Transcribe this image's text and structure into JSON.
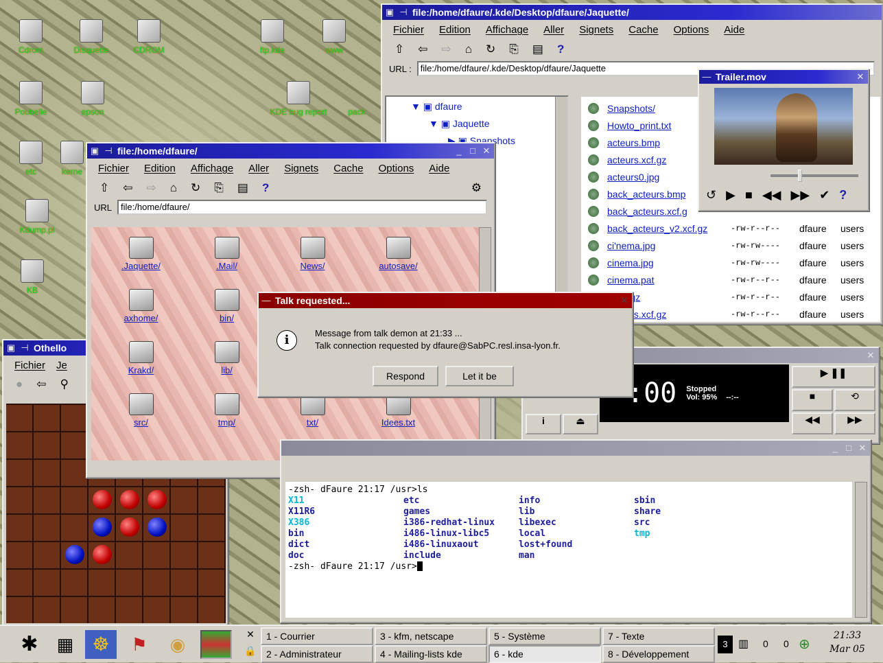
{
  "desktop": {
    "icons": [
      {
        "label": "Cdrom"
      },
      {
        "label": "Disquette"
      },
      {
        "label": "CDROM"
      },
      {
        "label": "ftp.kde"
      },
      {
        "label": "www"
      },
      {
        "label": "Poubelle"
      },
      {
        "label": "epson"
      },
      {
        "label": "KDE bug report"
      },
      {
        "label": "pack"
      },
      {
        "label": "etc"
      },
      {
        "label": "kerne"
      },
      {
        "label": "Kdump.pl"
      },
      {
        "label": "KB"
      }
    ]
  },
  "win_jaquette": {
    "title": "file:/home/dfaure/.kde/Desktop/dfaure/Jaquette/",
    "menu": [
      "Fichier",
      "Edition",
      "Affichage",
      "Aller",
      "Signets",
      "Cache",
      "Options",
      "Aide"
    ],
    "url_label": "URL :",
    "url": "file:/home/dfaure/.kde/Desktop/dfaure/Jaquette",
    "tree": [
      "dfaure",
      "Jaquette",
      "Snapshots"
    ],
    "files": [
      {
        "name": "Snapshots/",
        "perm": "",
        "owner": "",
        "group": ""
      },
      {
        "name": "Howto_print.txt",
        "perm": "",
        "owner": "",
        "group": ""
      },
      {
        "name": "acteurs.bmp",
        "perm": "",
        "owner": "",
        "group": ""
      },
      {
        "name": "acteurs.xcf.gz",
        "perm": "",
        "owner": "",
        "group": ""
      },
      {
        "name": "acteurs0.jpg",
        "perm": "",
        "owner": "",
        "group": ""
      },
      {
        "name": "back_acteurs.bmp",
        "perm": "",
        "owner": "",
        "group": ""
      },
      {
        "name": "back_acteurs.xcf.g",
        "perm": "",
        "owner": "",
        "group": ""
      },
      {
        "name": "back_acteurs_v2.xcf.gz",
        "perm": "-rw-r--r--",
        "owner": "dfaure",
        "group": "users"
      },
      {
        "name": "ci'nema.jpg",
        "perm": "-rw-rw----",
        "owner": "dfaure",
        "group": "users"
      },
      {
        "name": "cinema.jpg",
        "perm": "-rw-rw----",
        "owner": "dfaure",
        "group": "users"
      },
      {
        "name": "cinema.pat",
        "perm": "-rw-r--r--",
        "owner": "dfaure",
        "group": "users"
      },
      {
        "name": "a.xcf.gz",
        "perm": "-rw-r--r--",
        "owner": "dfaure",
        "group": "users"
      },
      {
        "name": "acteurs.xcf.gz",
        "perm": "-rw-r--r--",
        "owner": "dfaure",
        "group": "users"
      }
    ]
  },
  "win_trailer": {
    "title": "Trailer.mov"
  },
  "win_home": {
    "title": "file:/home/dfaure/",
    "menu": [
      "Fichier",
      "Edition",
      "Affichage",
      "Aller",
      "Signets",
      "Cache",
      "Options",
      "Aide"
    ],
    "url_label": "URL",
    "url": "file:/home/dfaure/",
    "items": [
      ".Jaquette/",
      ".Mail/",
      "News/",
      "autosave/",
      "axhome/",
      "bin/",
      "",
      "",
      "Krakd/",
      "lib/",
      "",
      "",
      "src/",
      "tmp/",
      "txt/",
      "Idees.txt"
    ]
  },
  "dialog": {
    "title": "Talk requested...",
    "line1": "Message from talk demon at 21:33 ...",
    "line2": "Talk connection requested by dfaure@SabPC.resl.insa-lyon.fr.",
    "respond": "Respond",
    "letbe": "Let it be"
  },
  "win_othello": {
    "title": "Othello",
    "menu": [
      "Fichier",
      "Je"
    ]
  },
  "player": {
    "time": ":00",
    "status": "Stopped",
    "vol": "Vol: 95%",
    "extra": "--:--"
  },
  "terminal": {
    "lines": [
      {
        "a": "-zsh- dFaure 21:17 /usr>ls",
        "b": "",
        "c": "",
        "d": ""
      },
      {
        "a": "X11",
        "b": "etc",
        "c": "info",
        "d": "sbin"
      },
      {
        "a": "X11R6",
        "b": "games",
        "c": "lib",
        "d": "share"
      },
      {
        "a": "X386",
        "b": "i386-redhat-linux",
        "c": "libexec",
        "d": "src"
      },
      {
        "a": "bin",
        "b": "i486-linux-libc5",
        "c": "local",
        "d": "tmp"
      },
      {
        "a": "dict",
        "b": "i486-linuxaout",
        "c": "lost+found",
        "d": ""
      },
      {
        "a": "doc",
        "b": "include",
        "c": "man",
        "d": ""
      },
      {
        "a": "-zsh- dFaure 21:17 /usr>",
        "b": "",
        "c": "",
        "d": ""
      }
    ]
  },
  "taskbar": {
    "tasks": [
      "1 - Courrier",
      "3 - kfm, netscape",
      "5 - Système",
      "7 - Texte",
      "2 - Administrateur",
      "4 - Mailing-lists kde",
      "6 - kde",
      "8 - Développement"
    ],
    "clock_time": "21:33",
    "clock_date": "Mar 05",
    "tray": [
      "3",
      "0",
      "0"
    ]
  }
}
